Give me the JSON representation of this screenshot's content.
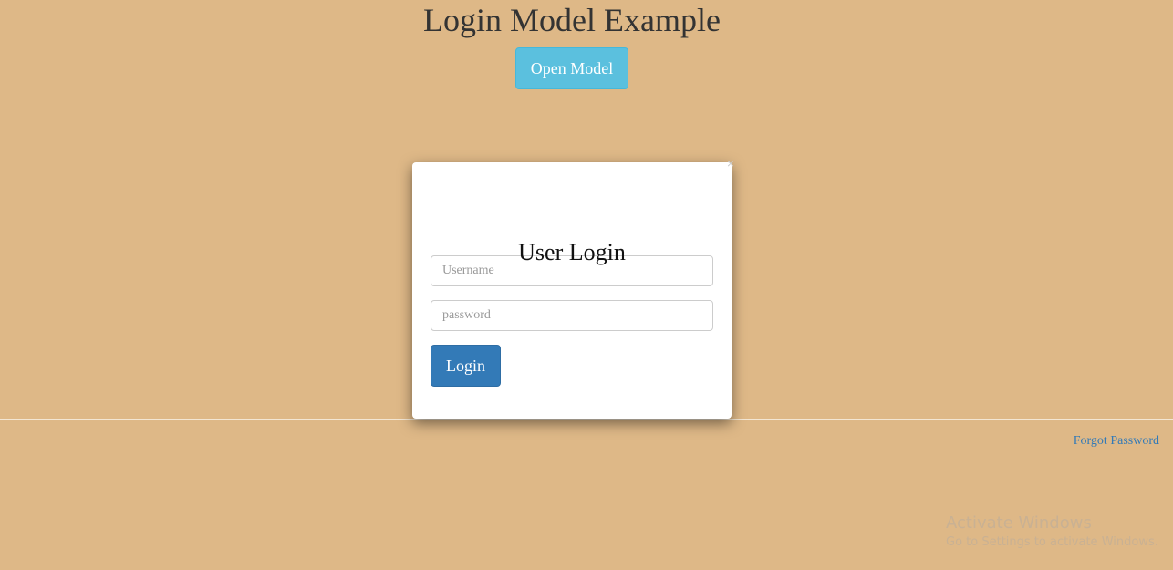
{
  "page": {
    "title": "Login Model Example",
    "open_button_label": "Open Model",
    "forgot_password_label": "Forgot Password"
  },
  "modal": {
    "close_glyph": "×",
    "title": "User Login",
    "username": {
      "value": "",
      "placeholder": "Username"
    },
    "password": {
      "value": "",
      "placeholder": "password"
    },
    "login_label": "Login"
  },
  "watermark": {
    "title": "Activate Windows",
    "subtitle": "Go to Settings to activate Windows."
  },
  "colors": {
    "background": "#deb887",
    "info_button": "#5bc0de",
    "primary_button": "#337ab7",
    "link": "#337ab7"
  }
}
